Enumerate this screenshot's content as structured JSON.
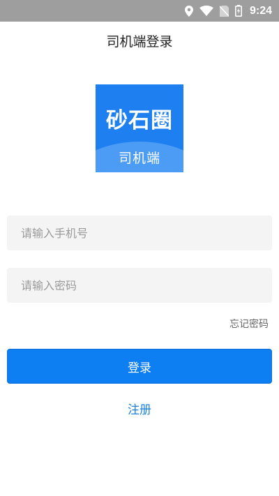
{
  "status_bar": {
    "time": "9:24",
    "icons": [
      "location-icon",
      "wifi-icon",
      "no-sim-icon",
      "battery-charging-icon"
    ]
  },
  "header": {
    "title": "司机端登录"
  },
  "logo": {
    "main_text": "砂石圈",
    "sub_text": "司机端"
  },
  "form": {
    "phone_placeholder": "请输入手机号",
    "phone_value": "",
    "password_placeholder": "请输入密码",
    "password_value": "",
    "forgot_label": "忘记密码",
    "login_label": "登录",
    "register_label": "注册"
  },
  "colors": {
    "status_bar": "#9e9e9e",
    "primary": "#0d7ff2",
    "logo_bg": "#1d7ff0",
    "input_bg": "#f4f4f4",
    "link": "#1a7fe0"
  }
}
